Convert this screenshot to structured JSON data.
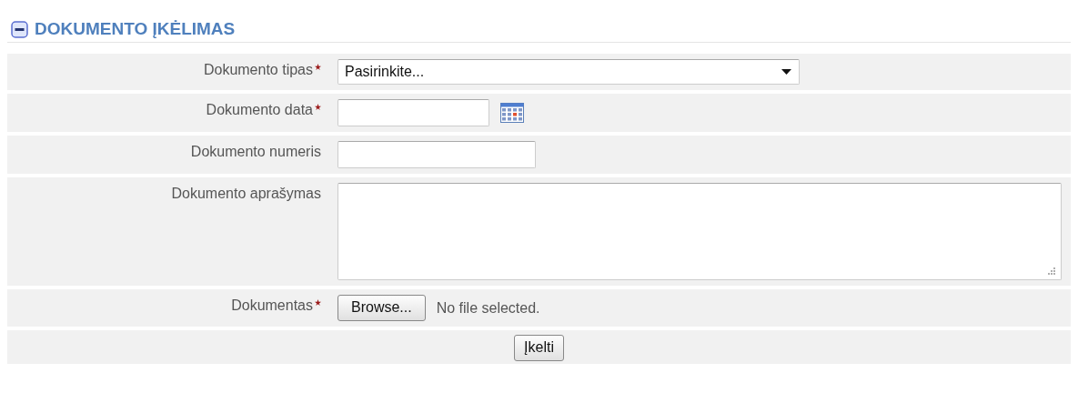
{
  "section": {
    "title": "DOKUMENTO ĮKĖLIMAS",
    "expanded": true
  },
  "fields": [
    {
      "kind": "select",
      "label": "Dokumento tipas",
      "required": true,
      "value": "Pasirinkite..."
    },
    {
      "kind": "date",
      "label": "Dokumento data",
      "required": true
    },
    {
      "kind": "text",
      "label": "Dokumento numeris",
      "required": false
    },
    {
      "kind": "textarea",
      "label": "Dokumento aprašymas",
      "required": false
    },
    {
      "kind": "file",
      "label": "Dokumentas",
      "required": true,
      "button": "Browse...",
      "status": "No file selected."
    }
  ],
  "submit": "Įkelti"
}
